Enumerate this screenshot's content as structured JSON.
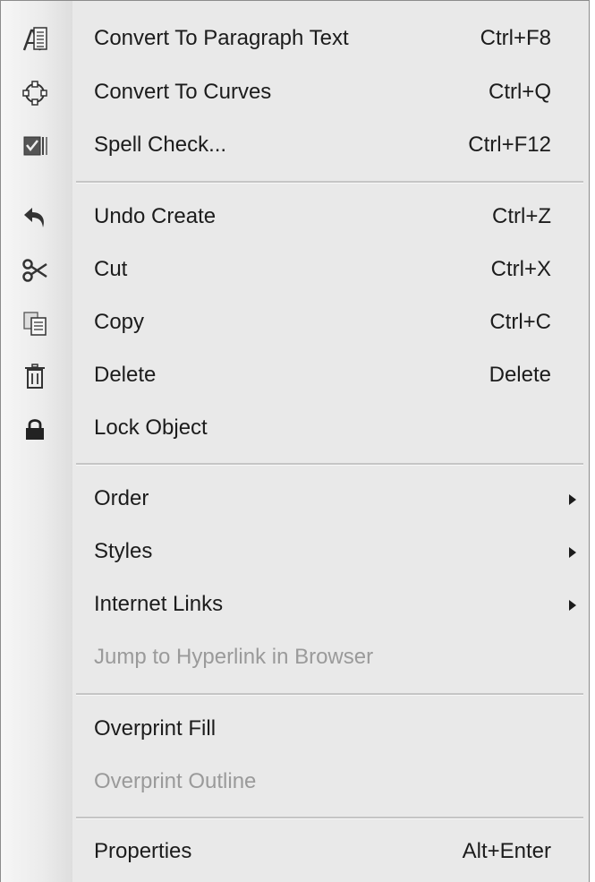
{
  "menu": {
    "items": [
      {
        "label": "Convert To Paragraph Text",
        "shortcut": "Ctrl+F8",
        "icon": "paragraph-text-icon"
      },
      {
        "label": "Convert To Curves",
        "shortcut": "Ctrl+Q",
        "icon": "convert-curves-icon"
      },
      {
        "label": "Spell Check...",
        "shortcut": "Ctrl+F12",
        "icon": "spell-check-icon"
      },
      {
        "label": "Undo Create",
        "shortcut": "Ctrl+Z",
        "icon": "undo-icon"
      },
      {
        "label": "Cut",
        "shortcut": "Ctrl+X",
        "icon": "scissors-icon"
      },
      {
        "label": "Copy",
        "shortcut": "Ctrl+C",
        "icon": "copy-icon"
      },
      {
        "label": "Delete",
        "shortcut": "Delete",
        "icon": "trash-icon"
      },
      {
        "label": "Lock Object",
        "shortcut": "",
        "icon": "lock-icon"
      },
      {
        "label": "Order",
        "submenu": true
      },
      {
        "label": "Styles",
        "submenu": true
      },
      {
        "label": "Internet Links",
        "submenu": true
      },
      {
        "label": "Jump to Hyperlink in Browser",
        "disabled": true
      },
      {
        "label": "Overprint Fill"
      },
      {
        "label": "Overprint Outline",
        "disabled": true
      },
      {
        "label": "Properties",
        "shortcut": "Alt+Enter"
      }
    ]
  }
}
